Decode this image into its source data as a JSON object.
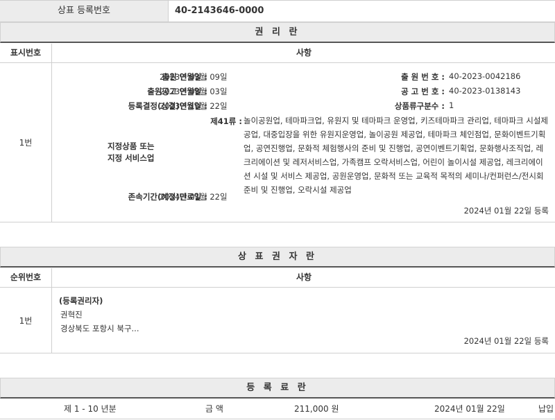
{
  "reg": {
    "label": "상표 등록번호",
    "value": "40-2143646-0000"
  },
  "rights": {
    "title": "권 리 란",
    "col_num": "표시번호",
    "col_content": "사항",
    "row_num": "1번",
    "app_date_label": "출원 연월일 :",
    "app_date": "2023년 03월 09일",
    "app_no_label": "출 원 번 호 :",
    "app_no": "40-2023-0042186",
    "pub_date_label": "출원공고 연월일 :",
    "pub_date": "2023년 08월 03일",
    "pub_no_label": "공 고 번 호 :",
    "pub_no": "40-2023-0138143",
    "decision_label": "등록결정(심결)연월일 :",
    "decision_date": "2023년 10월 22일",
    "class_count_label": "상품류구분수 :",
    "class_count": "1",
    "goods_label_1": "지정상품 또는",
    "goods_label_2": "지정 서비스업",
    "goods_class": "제41류 :",
    "goods_text": "놀이공원업, 테마파크업, 유원지 및 테마파크 운영업, 키즈테마파크 관리업, 테마파크 시설제공업, 대중입장을 위한 유원지운영업, 놀이공원 제공업, 테마파크 체인점업, 문화이벤트기획업, 공연진행업, 문화적 체험행사의 준비 및 진행업, 공연이벤트기획업, 문화행사조직업, 레크리에이션 및 레저서비스업, 가족캠프 오락서비스업, 어린이 놀이시설 제공업, 레크리에이션 시설 및 서비스 제공업, 공원운영업, 문화적 또는 교육적 목적의 세미나/컨퍼런스/전시회 준비 및 진행업, 오락시설 제공업",
    "expiry_label": "존속기간(예정)만료일 :",
    "expiry_date": "2034년 01월 22일",
    "registered": "2024년 01월 22일 등록"
  },
  "owner": {
    "title": "상 표 권 자 란",
    "col_num": "순위번호",
    "col_content": "사항",
    "row_num": "1번",
    "role": "(등록권리자)",
    "name": "권혁진",
    "address": "경상북도 포항시 북구...",
    "registered": "2024년 01월 22일 등록"
  },
  "fees": {
    "title": "등 록 료 란",
    "period": "제 1 - 10 년분",
    "amount_label": "금 액",
    "amount": "211,000 원",
    "date": "2024년 01월 22일",
    "status": "납입"
  }
}
